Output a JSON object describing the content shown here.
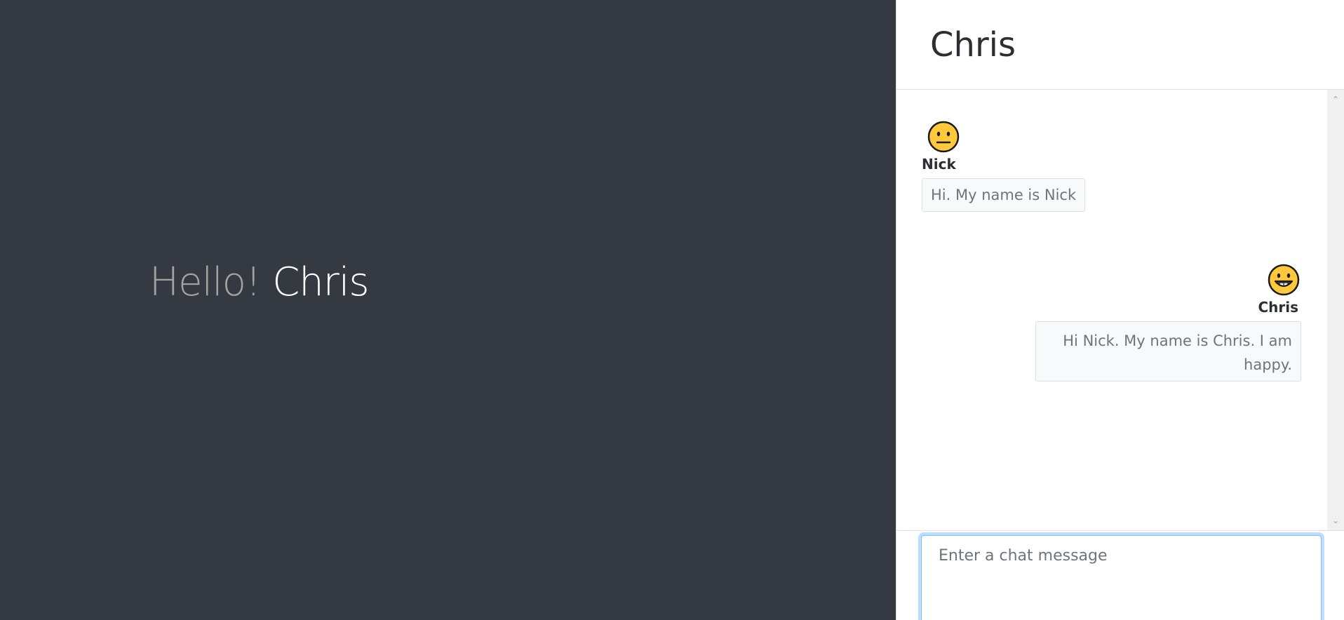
{
  "greeting": {
    "hello": "Hello!",
    "name": "Chris"
  },
  "chat": {
    "title": "Chris",
    "messages": [
      {
        "sender": "Nick",
        "avatar": "neutral-face-emoji",
        "text": "Hi. My name is Nick",
        "side": "left"
      },
      {
        "sender": "Chris",
        "avatar": "grinning-face-emoji",
        "text": "Hi Nick. My name is Chris. I am happy.",
        "side": "right"
      }
    ],
    "composer": {
      "placeholder": "Enter a chat message",
      "value": ""
    }
  },
  "colors": {
    "left_bg": "#353941",
    "hello_text": "#a3a3a3",
    "name_text": "#ffffff",
    "emoji_yellow": "#ffc83d",
    "focus_border": "#80bdff"
  }
}
